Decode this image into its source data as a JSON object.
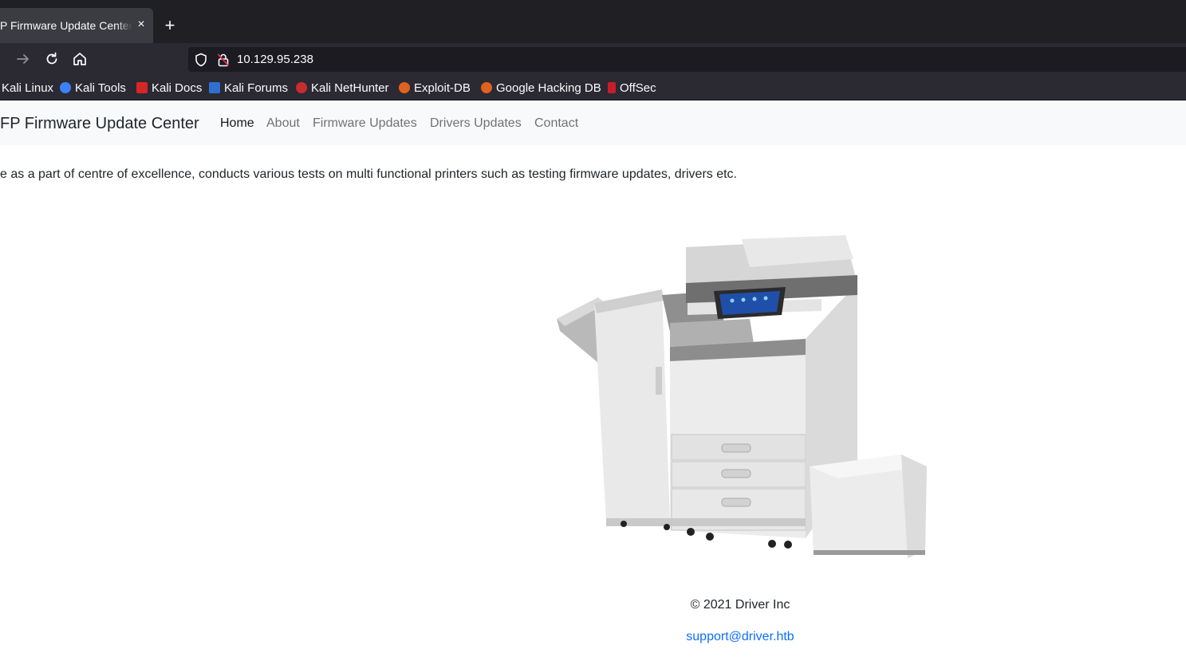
{
  "browser": {
    "tab_title": "P Firmware Update Center",
    "tab_close": "×",
    "new_tab": "+",
    "url": "10.129.95.238",
    "bookmarks": [
      {
        "label": "Kali Linux",
        "icon": "kali-icon"
      },
      {
        "label": "Kali Tools",
        "icon": "kali-tools-icon"
      },
      {
        "label": "Kali Docs",
        "icon": "kali-docs-icon"
      },
      {
        "label": "Kali Forums",
        "icon": "kali-forums-icon"
      },
      {
        "label": "Kali NetHunter",
        "icon": "nethunter-icon"
      },
      {
        "label": "Exploit-DB",
        "icon": "exploit-db-icon"
      },
      {
        "label": "Google Hacking DB",
        "icon": "ghdb-icon"
      },
      {
        "label": "OffSec",
        "icon": "offsec-icon"
      }
    ]
  },
  "site": {
    "brand": "FP Firmware Update Center",
    "menu": [
      {
        "label": "Home",
        "active": true
      },
      {
        "label": "About",
        "active": false
      },
      {
        "label": "Firmware Updates",
        "active": false
      },
      {
        "label": "Drivers Updates",
        "active": false
      },
      {
        "label": "Contact",
        "active": false
      }
    ],
    "intro": "e as a part of centre of excellence, conducts various tests on multi functional printers such as testing firmware updates, drivers etc.",
    "image": "printer-image",
    "footer": {
      "copyright": "© 2021 Driver Inc",
      "email": "support@driver.htb"
    }
  },
  "colors": {
    "tab_bg": "#1f1f24",
    "toolbar_bg": "#2b2a33",
    "nav_bg": "#f8f9fa",
    "link": "#0d6efd",
    "text": "#212529"
  }
}
